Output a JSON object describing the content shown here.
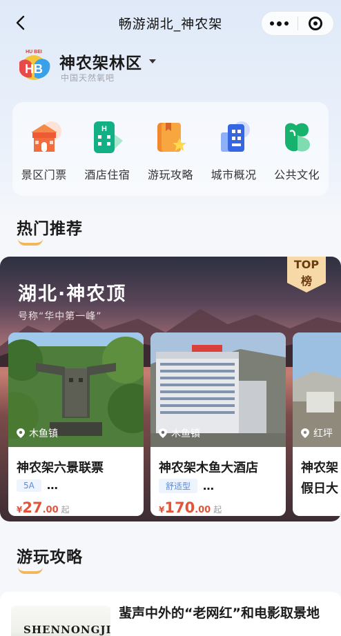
{
  "topbar": {
    "title": "畅游湖北_神农架"
  },
  "location": {
    "name": "神农架林区",
    "subtitle": "中国天然氧吧",
    "logo_caption": "HU BEI",
    "logo_text": "HB"
  },
  "services": [
    {
      "label": "景区门票",
      "icon": "scenic-ticket-icon",
      "color": "#f06a3b"
    },
    {
      "label": "酒店住宿",
      "icon": "hotel-icon",
      "color": "#1fb38a"
    },
    {
      "label": "游玩攻略",
      "icon": "guide-book-icon",
      "color": "#f39a2b"
    },
    {
      "label": "城市概况",
      "icon": "city-overview-icon",
      "color": "#3a6fe6"
    },
    {
      "label": "公共文化",
      "icon": "culture-icon",
      "color": "#1eb36f"
    }
  ],
  "hot": {
    "section_title": "热门推荐",
    "headline": "湖北·神农顶",
    "subline": "号称“华中第一峰”",
    "badge_top": "TOP",
    "badge_bottom": "榜",
    "cards": [
      {
        "location": "木鱼镇",
        "name": "神农架六景联票",
        "tag": "5A",
        "dots": "…",
        "currency": "¥",
        "price_int": "27",
        "price_dec": ".00",
        "suffix": "起"
      },
      {
        "location": "木鱼镇",
        "name": "神农架木鱼大酒店",
        "tag": "舒适型",
        "dots": "…",
        "currency": "¥",
        "price_int": "170",
        "price_dec": ".00",
        "suffix": "起"
      },
      {
        "location": "红坪",
        "name": "神农架",
        "name2": "假日大"
      }
    ]
  },
  "guide": {
    "section_title": "游玩攻略",
    "article_title": "蜚声中外的“老网红”和电影取景地",
    "thumb_text": "SHENNONGJIA"
  }
}
